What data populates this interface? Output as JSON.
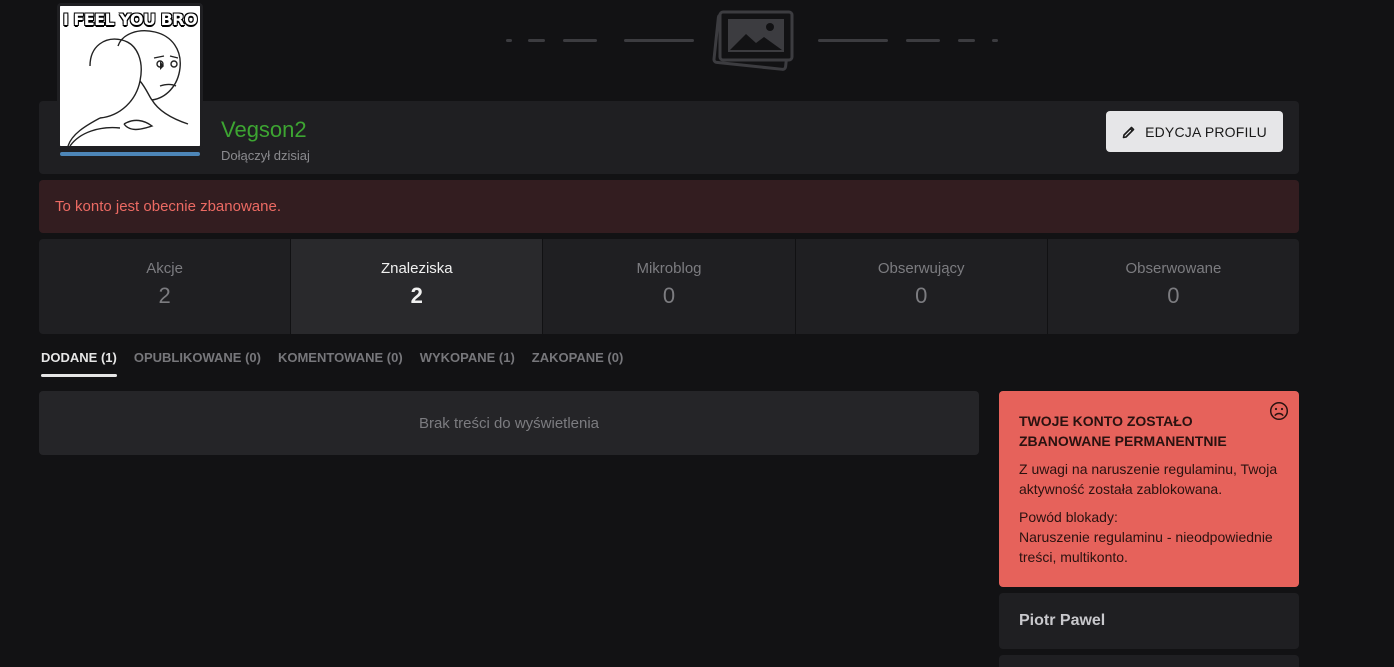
{
  "profile": {
    "avatar_caption": "I FEEL YOU BRO",
    "username": "Vegson2",
    "joined": "Dołączył dzisiaj",
    "edit_label": "EDYCJA PROFILU"
  },
  "ban_alert": "To konto jest obecnie zbanowane.",
  "stats": [
    {
      "label": "Akcje",
      "value": "2"
    },
    {
      "label": "Znaleziska",
      "value": "2"
    },
    {
      "label": "Mikroblog",
      "value": "0"
    },
    {
      "label": "Obserwujący",
      "value": "0"
    },
    {
      "label": "Obserwowane",
      "value": "0"
    }
  ],
  "tabs": [
    {
      "label": "DODANE (1)"
    },
    {
      "label": "OPUBLIKOWANE (0)"
    },
    {
      "label": "KOMENTOWANE (0)"
    },
    {
      "label": "WYKOPANE (1)"
    },
    {
      "label": "ZAKOPANE (0)"
    }
  ],
  "content": {
    "empty_message": "Brak treści do wyświetlenia"
  },
  "ban_card": {
    "title": "TWOJE KONTO ZOSTAŁO ZBANOWANE PERMANENTNIE",
    "text": "Z uwagi na naruszenie regulaminu, Twoja aktywność została zablokowana.",
    "reason_label": "Powód blokady:",
    "reason": "Naruszenie regulaminu - nieodpowiednie treści, multikonto."
  },
  "sidebar_user": {
    "name": "Piotr Pawel"
  },
  "colors": {
    "background": "#121214",
    "card": "#1f1f22",
    "username": "#3da532",
    "ban_alert_bg": "#331d20",
    "ban_alert_text": "#ec6a63",
    "ban_card_bg": "#e6625b",
    "avatar_bar": "#4d86b8"
  },
  "icons": {
    "cover": "image-placeholder-icon",
    "edit": "pencil-icon",
    "ban": "sad-face-icon"
  }
}
